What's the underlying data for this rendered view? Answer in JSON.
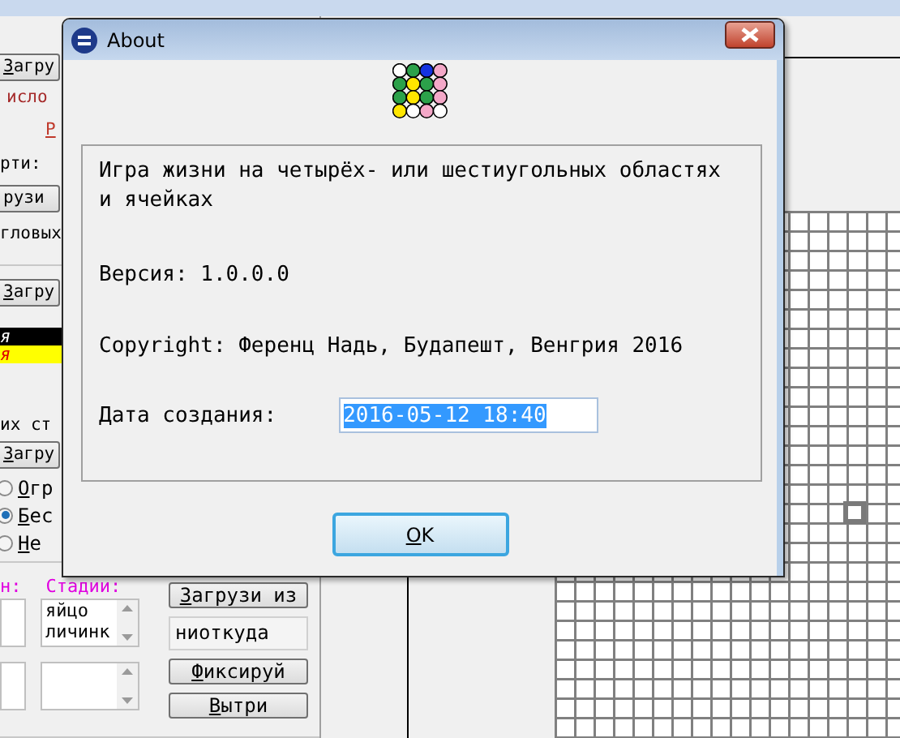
{
  "left_panel": [
    {
      "kind": "button",
      "text": "Загру",
      "mnemonic": true
    },
    {
      "kind": "red_label",
      "text": "исло"
    },
    {
      "kind": "link",
      "text": "Р"
    },
    {
      "kind": "label",
      "text": "рти:"
    },
    {
      "kind": "button",
      "text": "рузи",
      "mnemonic": false
    },
    {
      "kind": "label",
      "text": "гловых"
    },
    {
      "kind": "divider"
    },
    {
      "kind": "button",
      "text": "Загру",
      "mnemonic": true
    },
    {
      "kind": "list",
      "items": [
        {
          "text": "я",
          "color": "#000000"
        },
        {
          "text": "я",
          "color": "#ffff00"
        }
      ]
    },
    {
      "kind": "label",
      "text": "их ст"
    },
    {
      "kind": "button",
      "text": "Загру",
      "mnemonic": true
    },
    {
      "kind": "radio_group",
      "options": [
        {
          "text": "Огр",
          "selected": false
        },
        {
          "text": "Бес",
          "selected": true
        },
        {
          "text": "Не",
          "selected": false
        }
      ]
    },
    {
      "kind": "divider"
    }
  ],
  "bottom_panel": {
    "label_1": "н:",
    "label_2": "Стадии:",
    "stages": [
      "яйцо",
      "личинк"
    ],
    "buttons": [
      {
        "kind": "button",
        "text": "Загрузи из",
        "mnemonic": true
      },
      {
        "kind": "field",
        "text": "ниоткуда"
      },
      {
        "kind": "button",
        "text": "Фиксируй",
        "mnemonic": true
      },
      {
        "kind": "button",
        "text": "Вытри",
        "mnemonic": true
      }
    ]
  },
  "dialog": {
    "title": "About",
    "description": "Игра жизни на четырёх- или шестиугольных областях и ячейках",
    "version": "Версия: 1.0.0.0",
    "copyright": "Copyright: Ференц Надь, Будапешт, Венгрия 2016",
    "date_label": "Дата создания:",
    "date_value": "2016-05-12 18:40",
    "date_selected": true,
    "ok_button": "OK",
    "ok_focused": true
  }
}
